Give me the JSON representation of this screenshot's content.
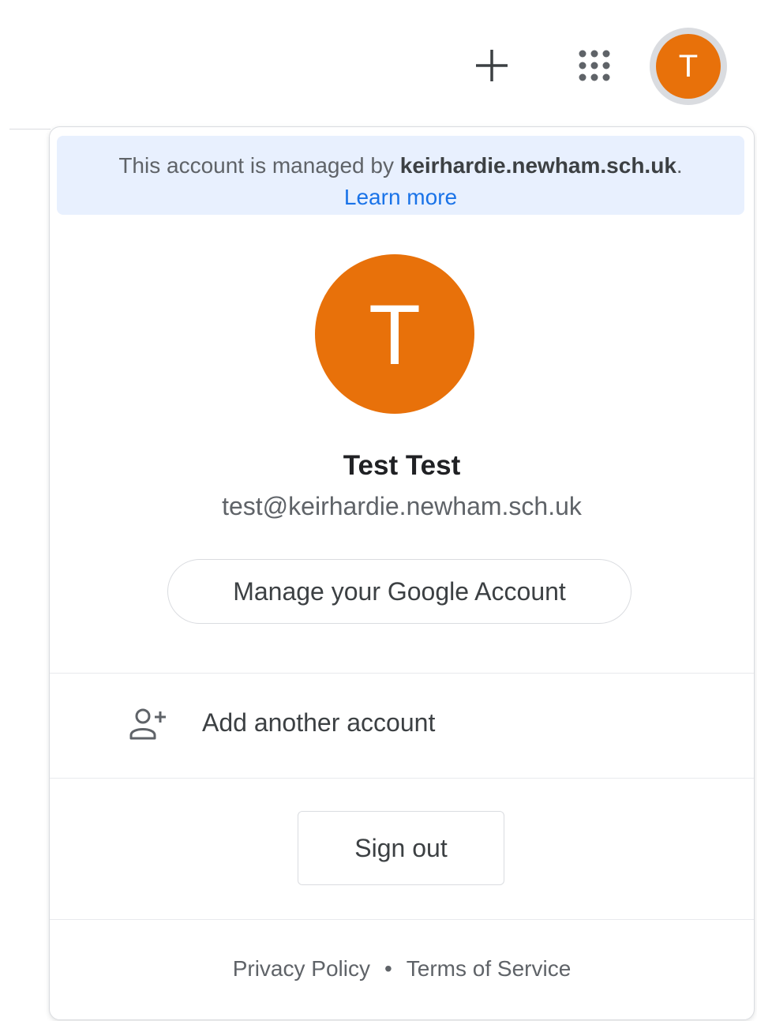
{
  "topbar": {
    "plus_icon": "plus-icon",
    "apps_icon": "apps-grid-icon",
    "avatar_initial": "T",
    "avatar_color": "#e8710a"
  },
  "account_panel": {
    "banner": {
      "prefix": "This account is managed by ",
      "domain": "keirhardie.newham.sch.uk",
      "suffix": ".",
      "learn_more": "Learn more",
      "background": "#e8f0fe",
      "link_color": "#1a73e8"
    },
    "avatar_initial": "T",
    "name": "Test Test",
    "email": "test@keirhardie.newham.sch.uk",
    "manage_button": "Manage your Google Account",
    "add_account": {
      "label": "Add another account",
      "icon": "add-person-icon"
    },
    "sign_out_button": "Sign out",
    "footer": {
      "privacy": "Privacy Policy",
      "separator": "•",
      "terms": "Terms of Service"
    }
  }
}
